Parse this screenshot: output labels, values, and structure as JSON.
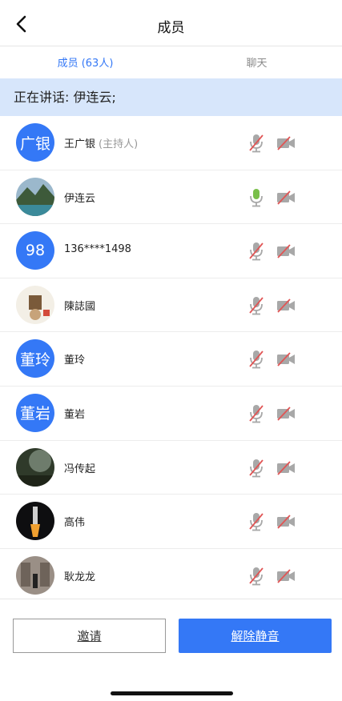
{
  "header": {
    "title": "成员"
  },
  "tabs": [
    {
      "label": "成员 (63人)"
    },
    {
      "label": "聊天"
    }
  ],
  "speaking": {
    "text": "正在讲话: 伊连云;"
  },
  "members": [
    {
      "name": "王广银",
      "role": "(主持人)",
      "avatar_text": "广银",
      "mic": "muted"
    },
    {
      "name": "伊连云",
      "avatar_text": "",
      "mic": "active"
    },
    {
      "name": "136****1498",
      "avatar_text": "98",
      "mic": "muted"
    },
    {
      "name": "陳誌國",
      "avatar_text": "",
      "mic": "muted"
    },
    {
      "name": "董玲",
      "avatar_text": "董玲",
      "mic": "muted"
    },
    {
      "name": "董岩",
      "avatar_text": "董岩",
      "mic": "muted"
    },
    {
      "name": "冯传起",
      "avatar_text": "",
      "mic": "muted"
    },
    {
      "name": "高伟",
      "avatar_text": "",
      "mic": "muted"
    },
    {
      "name": "耿龙龙",
      "avatar_text": "",
      "mic": "muted"
    }
  ],
  "actions": {
    "invite_label": "邀请",
    "unmute_label": "解除静音"
  },
  "colors": {
    "accent": "#3478f6",
    "speaking_bg": "#d7e6fb",
    "icon_gray": "#a8a8a8",
    "mic_active": "#79bf4a",
    "muted_slash": "#e05555"
  }
}
